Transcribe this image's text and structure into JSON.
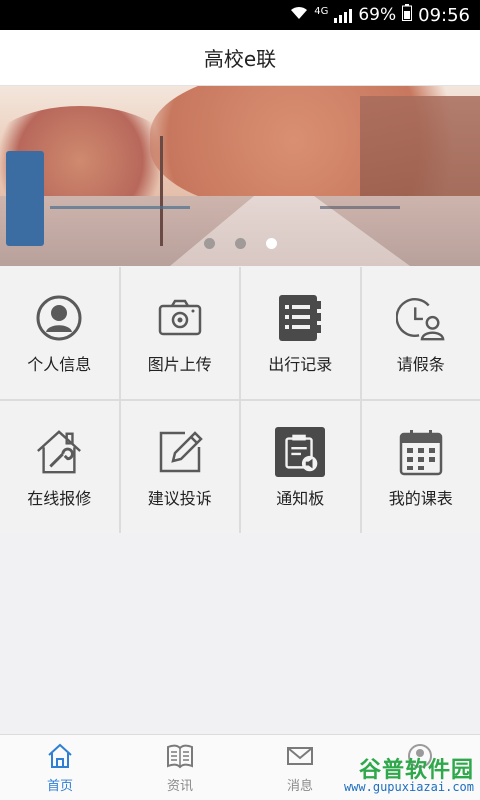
{
  "status_bar": {
    "network": "4G",
    "battery": "69%",
    "time": "09:56"
  },
  "header": {
    "title": "高校e联"
  },
  "banner": {
    "slides": 3,
    "active_slide": 3
  },
  "grid": {
    "items": [
      {
        "label": "个人信息",
        "icon": "person-icon"
      },
      {
        "label": "图片上传",
        "icon": "camera-icon"
      },
      {
        "label": "出行记录",
        "icon": "notebook-icon"
      },
      {
        "label": "请假条",
        "icon": "clock-person-icon"
      },
      {
        "label": "在线报修",
        "icon": "house-wrench-icon"
      },
      {
        "label": "建议投诉",
        "icon": "edit-icon"
      },
      {
        "label": "通知板",
        "icon": "clipboard-speaker-icon"
      },
      {
        "label": "我的课表",
        "icon": "calendar-icon"
      }
    ]
  },
  "bottom_nav": {
    "tabs": [
      {
        "label": "首页",
        "icon": "home-icon",
        "active": true
      },
      {
        "label": "资讯",
        "icon": "book-icon",
        "active": false
      },
      {
        "label": "消息",
        "icon": "mail-icon",
        "active": false
      },
      {
        "label": "",
        "icon": "user-icon",
        "active": false
      }
    ]
  },
  "watermark": {
    "name": "谷普软件园",
    "url": "www.gupuxiazai.com"
  },
  "colors": {
    "accent": "#2f7fd3",
    "icon_gray": "#5a5a5a"
  }
}
